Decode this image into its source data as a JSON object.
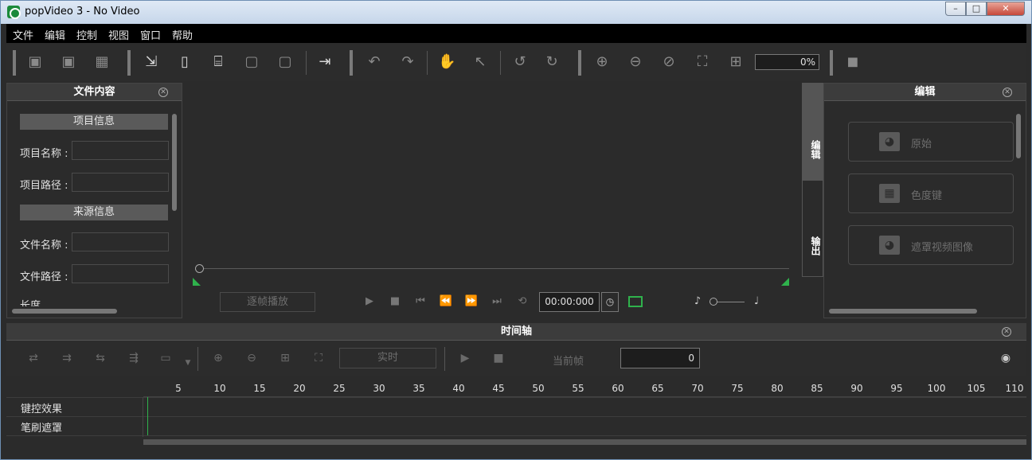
{
  "window": {
    "title": "popVideo 3 - No Video",
    "min": "–",
    "max": "□",
    "close": "✕"
  },
  "menu": [
    "文件",
    "编辑",
    "控制",
    "视图",
    "窗口",
    "帮助"
  ],
  "toolbar": {
    "zoom_value": "0%"
  },
  "left_panel": {
    "title": "文件内容",
    "project_section": "项目信息",
    "project_name_label": "项目名称 :",
    "project_path_label": "项目路径 :",
    "source_section": "来源信息",
    "file_name_label": "文件名称 :",
    "file_path_label": "文件路径 :",
    "partial_label": "长度"
  },
  "preview": {
    "frame_play_label": "逐帧播放",
    "time": "00:00:000"
  },
  "side_tabs": {
    "edit": "编辑",
    "output": "输出"
  },
  "right_panel": {
    "title": "编辑",
    "items": [
      {
        "label": "原始",
        "icon": "person-icon"
      },
      {
        "label": "色度键",
        "icon": "checker-icon"
      },
      {
        "label": "遮罩视频图像",
        "icon": "mask-person-icon"
      }
    ]
  },
  "timeline": {
    "title": "时间轴",
    "realtime_label": "实时",
    "current_frame_label": "当前帧",
    "current_frame_value": "0",
    "ruler_ticks": [
      "5",
      "10",
      "15",
      "20",
      "25",
      "30",
      "35",
      "40",
      "45",
      "50",
      "55",
      "60",
      "65",
      "70",
      "75",
      "80",
      "85",
      "90",
      "95",
      "100",
      "105",
      "110"
    ],
    "tracks": [
      "键控效果",
      "笔刷遮罩"
    ]
  }
}
